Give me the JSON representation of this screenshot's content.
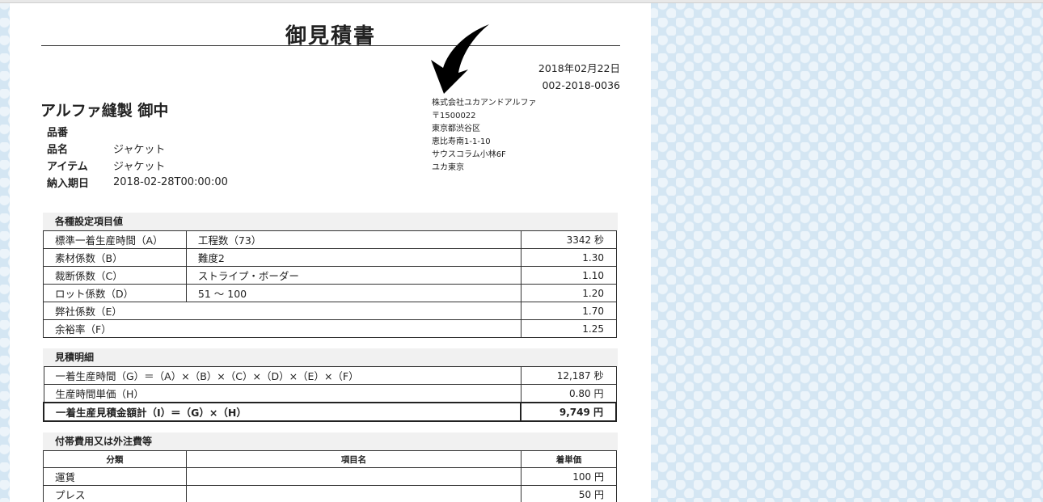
{
  "document": {
    "title": "御見積書",
    "date": "2018年02月22日",
    "number": "002-2018-0036",
    "client": "アルファ縫製 御中"
  },
  "company": {
    "name": "株式会社ユカアンドアルファ",
    "postal": "〒1500022",
    "city": "東京都渋谷区",
    "street": "恵比寿南1-1-10",
    "building": "サウスコラム小林6F",
    "branch": "ユカ東京"
  },
  "product": [
    {
      "label": "品番",
      "value": ""
    },
    {
      "label": "品名",
      "value": "ジャケット"
    },
    {
      "label": "アイテム",
      "value": "ジャケット"
    },
    {
      "label": "納入期日",
      "value": "2018-02-28T00:00:00"
    }
  ],
  "settings": {
    "heading": "各種設定項目値",
    "rows": [
      {
        "name": "標準一着生産時間（A）",
        "detail": "工程数（73）",
        "value": "3342 秒"
      },
      {
        "name": "素材係数（B）",
        "detail": "難度2",
        "value": "1.30"
      },
      {
        "name": "裁断係数（C）",
        "detail": "ストライプ・ボーダー",
        "value": "1.10"
      },
      {
        "name": "ロット係数（D）",
        "detail": "51 ～ 100",
        "value": "1.20"
      },
      {
        "name": "弊社係数（E）",
        "value": "1.70"
      },
      {
        "name": "余裕率（F）",
        "value": "1.25"
      }
    ]
  },
  "estimate": {
    "heading": "見積明細",
    "rows": [
      {
        "name": "一着生産時間（G）＝（A）×（B）×（C）×（D）×（E）×（F）",
        "value": "12,187 秒"
      },
      {
        "name": "生産時間単価（H）",
        "value": "0.80 円"
      },
      {
        "name": "一着生産見積金額計（I）＝（G）×（H）",
        "value": "9,749 円"
      }
    ]
  },
  "extras": {
    "heading": "付帯費用又は外注費等",
    "columns": [
      "分類",
      "項目名",
      "着単価"
    ],
    "rows": [
      {
        "category": "運賃",
        "item": "",
        "price": "100 円"
      },
      {
        "category": "プレス",
        "item": "",
        "price": "50 円"
      }
    ]
  }
}
